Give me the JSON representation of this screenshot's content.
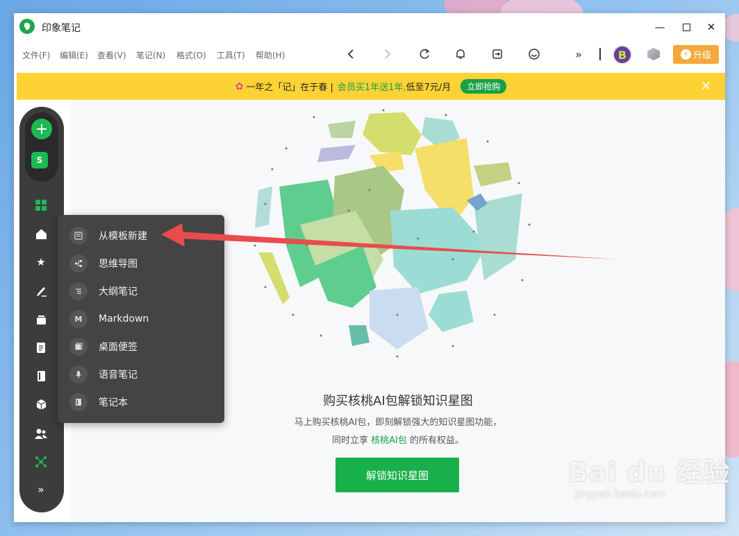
{
  "window": {
    "title": "印象笔记"
  },
  "menubar": {
    "items": [
      "文件(F)",
      "编辑(E)",
      "查看(V)",
      "笔记(N)",
      "格式(O)",
      "工具(T)",
      "帮助(H)"
    ]
  },
  "toolbar": {
    "upgrade_label": "升级",
    "avatar_letter": "B"
  },
  "banner": {
    "part1": "一年之「记」在于春 |",
    "green": "会员买1年送1年,",
    "part2": "低至7元/月",
    "button": "立即抢购"
  },
  "sidebar": {
    "s_label": "S"
  },
  "dropdown": {
    "items": [
      {
        "label": "从模板新建",
        "icon": "template-icon"
      },
      {
        "label": "思维导图",
        "icon": "mindmap-icon"
      },
      {
        "label": "大纲笔记",
        "icon": "outline-icon"
      },
      {
        "label": "Markdown",
        "icon": "markdown-icon"
      },
      {
        "label": "桌面便签",
        "icon": "sticky-note-icon"
      },
      {
        "label": "语音笔记",
        "icon": "microphone-icon"
      },
      {
        "label": "笔记本",
        "icon": "notebook-icon"
      }
    ]
  },
  "main": {
    "heading": "购买核桃AI包解锁知识星图",
    "desc_line1": "马上购买核桃AI包，即刻解锁强大的知识星图功能，",
    "desc_line2_pre": "同时立享",
    "desc_line2_link": "核桃AI包",
    "desc_line2_post": "的所有权益。",
    "unlock_button": "解锁知识星图"
  },
  "watermark": {
    "main": "Bai du 经验",
    "sub": "jingyan.baidu.com"
  },
  "colors": {
    "brand_green": "#18b04a",
    "banner_yellow": "#fdd235",
    "upgrade_orange": "#f2a93a",
    "arrow_red": "#e84c4c"
  }
}
